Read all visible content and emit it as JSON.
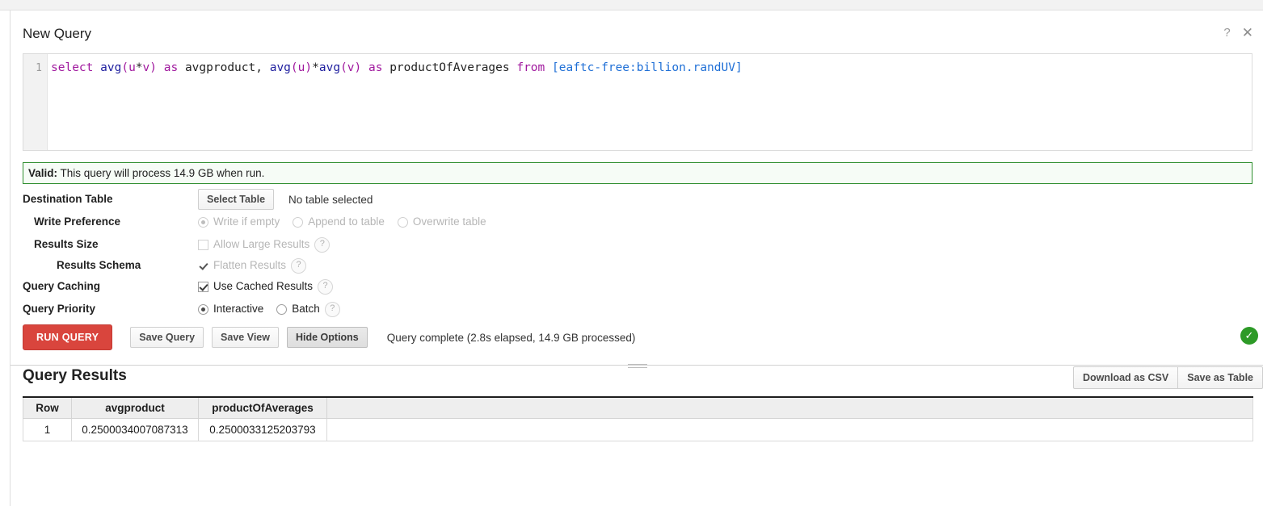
{
  "window": {
    "title": "New Query",
    "help_icon": "?",
    "close_icon": "✕"
  },
  "editor": {
    "line_number": "1",
    "query_tokens": [
      {
        "t": "select",
        "c": "kw"
      },
      {
        "t": " ",
        "c": "op"
      },
      {
        "t": "avg",
        "c": "fn"
      },
      {
        "t": "(",
        "c": "punc"
      },
      {
        "t": "u",
        "c": "var"
      },
      {
        "t": "*",
        "c": "op"
      },
      {
        "t": "v",
        "c": "var"
      },
      {
        "t": ")",
        "c": "punc"
      },
      {
        "t": " ",
        "c": "op"
      },
      {
        "t": "as",
        "c": "kw"
      },
      {
        "t": " ",
        "c": "op"
      },
      {
        "t": "avgproduct",
        "c": "id"
      },
      {
        "t": ", ",
        "c": "op"
      },
      {
        "t": "avg",
        "c": "fn"
      },
      {
        "t": "(",
        "c": "punc"
      },
      {
        "t": "u",
        "c": "var"
      },
      {
        "t": ")",
        "c": "punc"
      },
      {
        "t": "*",
        "c": "op"
      },
      {
        "t": "avg",
        "c": "fn"
      },
      {
        "t": "(",
        "c": "punc"
      },
      {
        "t": "v",
        "c": "var"
      },
      {
        "t": ")",
        "c": "punc"
      },
      {
        "t": " ",
        "c": "op"
      },
      {
        "t": "as",
        "c": "kw"
      },
      {
        "t": " ",
        "c": "op"
      },
      {
        "t": "productOfAverages",
        "c": "id"
      },
      {
        "t": " ",
        "c": "op"
      },
      {
        "t": "from",
        "c": "kw"
      },
      {
        "t": " ",
        "c": "op"
      },
      {
        "t": "[eaftc-free:billion.randUV]",
        "c": "tbl"
      }
    ],
    "query_text": "select avg(u*v) as avgproduct, avg(u)*avg(v) as productOfAverages from [eaftc-free:billion.randUV]"
  },
  "validation": {
    "label": "Valid:",
    "message": "This query will process 14.9 GB when run.",
    "border_color": "#2f8f2f"
  },
  "options": {
    "destination_table": {
      "label": "Destination Table",
      "button": "Select Table",
      "value": "No table selected"
    },
    "write_preference": {
      "label": "Write Preference",
      "choices": [
        {
          "label": "Write if empty",
          "selected": true,
          "disabled": true
        },
        {
          "label": "Append to table",
          "selected": false,
          "disabled": true
        },
        {
          "label": "Overwrite table",
          "selected": false,
          "disabled": true
        }
      ]
    },
    "results_size": {
      "label": "Results Size",
      "checkbox": {
        "label": "Allow Large Results",
        "checked": false,
        "disabled": true
      },
      "help": "?"
    },
    "results_schema": {
      "label": "Results Schema",
      "checkbox": {
        "label": "Flatten Results",
        "checked": true,
        "disabled": true
      },
      "help": "?"
    },
    "query_caching": {
      "label": "Query Caching",
      "checkbox": {
        "label": "Use Cached Results",
        "checked": true,
        "disabled": false
      },
      "help": "?"
    },
    "query_priority": {
      "label": "Query Priority",
      "choices": [
        {
          "label": "Interactive",
          "selected": true,
          "disabled": false
        },
        {
          "label": "Batch",
          "selected": false,
          "disabled": false
        }
      ],
      "help": "?"
    }
  },
  "actions": {
    "run_query": "RUN QUERY",
    "save_query": "Save Query",
    "save_view": "Save View",
    "hide_options": "Hide Options",
    "status": "Query complete (2.8s elapsed, 14.9 GB processed)",
    "status_badge_icon": "✓",
    "status_badge_color": "#2d9a27",
    "primary_color": "#d9453d"
  },
  "results": {
    "title": "Query Results",
    "download_csv": "Download as CSV",
    "save_as_table": "Save as Table",
    "columns": [
      "Row",
      "avgproduct",
      "productOfAverages",
      ""
    ],
    "rows": [
      {
        "row": "1",
        "avgproduct": "0.2500034007087313",
        "productOfAverages": "0.2500033125203793",
        "pad": ""
      }
    ]
  }
}
